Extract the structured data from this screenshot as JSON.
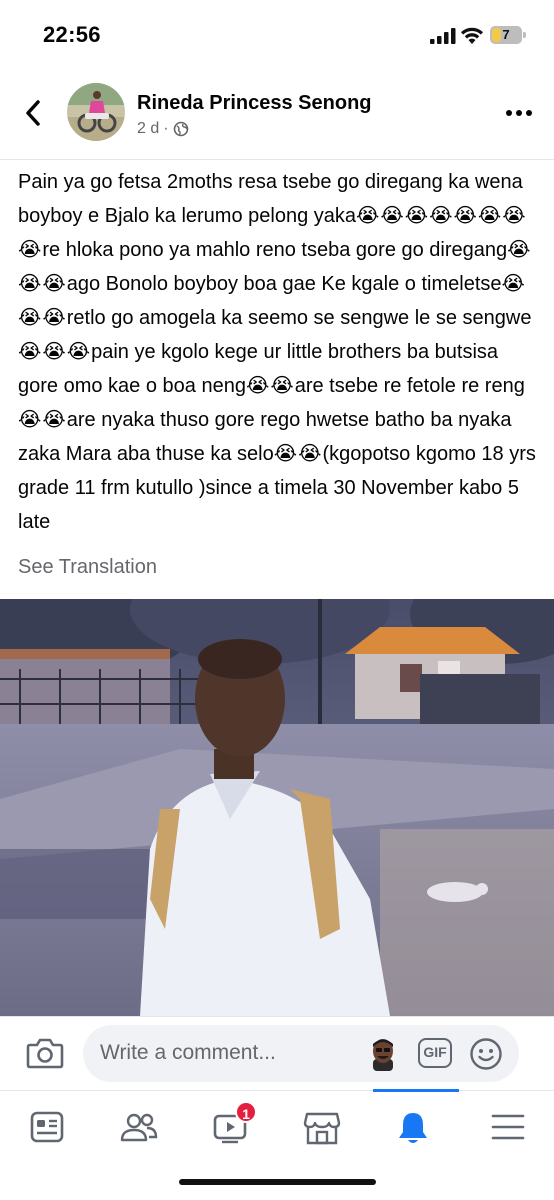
{
  "status_bar": {
    "time": "22:56",
    "battery_level": "7"
  },
  "post": {
    "author": "Rineda Princess Senong",
    "time_ago": "2 d",
    "meta_separator": "·",
    "privacy_icon": "globe-icon",
    "text_segments": [
      {
        "type": "text",
        "value": "Pain ya go fetsa 2moths resa tsebe go diregang ka wena boyboy e Bjalo ka lerumo pelong yaka"
      },
      {
        "type": "emoji",
        "value": "😭😭😭😭😭😭😭😭"
      },
      {
        "type": "text",
        "value": "re hloka pono ya mahlo reno tseba gore go diregang"
      },
      {
        "type": "emoji",
        "value": "😭😭😭"
      },
      {
        "type": "text",
        "value": "ago Bonolo boyboy boa gae Ke kgale o timeletse"
      },
      {
        "type": "emoji",
        "value": "😭😭😭"
      },
      {
        "type": "text",
        "value": "retlo go amogela ka seemo se sengwe le se sengwe"
      },
      {
        "type": "emoji",
        "value": "😭😭😭"
      },
      {
        "type": "text",
        "value": "pain ye kgolo kege ur little brothers ba butsisa gore omo kae o boa neng"
      },
      {
        "type": "emoji",
        "value": "😭😭"
      },
      {
        "type": "text",
        "value": "are tsebe re fetole re reng"
      },
      {
        "type": "emoji",
        "value": "😭😭"
      },
      {
        "type": "text",
        "value": "are nyaka thuso gore rego hwetse batho ba nyaka zaka Mara aba thuse ka selo"
      },
      {
        "type": "emoji",
        "value": "😭😭"
      },
      {
        "type": "text",
        "value": "(kgopotso kgomo 18 yrs grade 11  frm kutullo )since a timela 30 November kabo 5 late"
      }
    ],
    "see_translation": "See Translation"
  },
  "comment_bar": {
    "placeholder": "Write a comment...",
    "gif_label": "GIF"
  },
  "tab_bar": {
    "tabs": [
      {
        "name": "news-feed",
        "icon": "feed-icon"
      },
      {
        "name": "friends",
        "icon": "friends-icon"
      },
      {
        "name": "watch",
        "icon": "video-icon",
        "badge": "1"
      },
      {
        "name": "marketplace",
        "icon": "store-icon"
      },
      {
        "name": "notifications",
        "icon": "bell-icon",
        "active": true
      },
      {
        "name": "menu",
        "icon": "menu-icon"
      }
    ]
  },
  "colors": {
    "accent": "#1877f2",
    "badge": "#e41e3f",
    "secondary_text": "#65676b"
  }
}
